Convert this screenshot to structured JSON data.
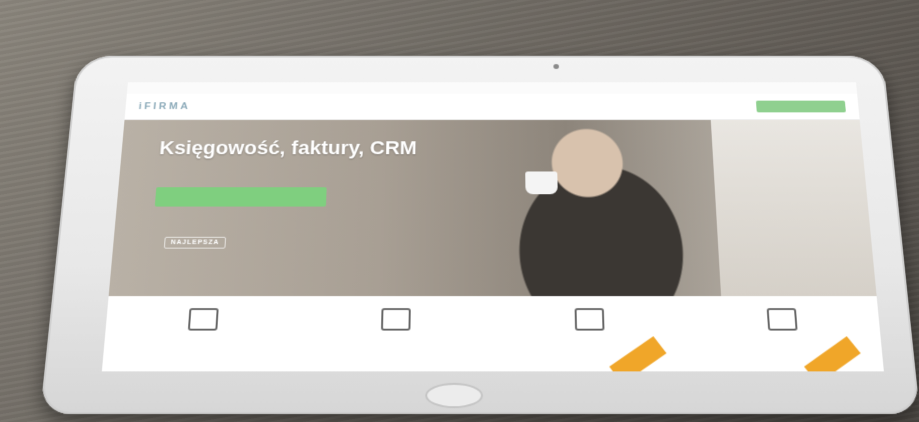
{
  "hero": {
    "title": "Księgowość, faktury, CRM",
    "badge": "NAJLEPSZA"
  },
  "brand": {
    "logo_text": "iFIRMA"
  },
  "colors": {
    "accent_green": "#7fcf7f",
    "ribbon_orange": "#f0a629",
    "logo_blue": "#8aa9b8"
  },
  "icons": [
    "laptop-icon",
    "printer-icon",
    "edit-icon",
    "coins-icon"
  ]
}
